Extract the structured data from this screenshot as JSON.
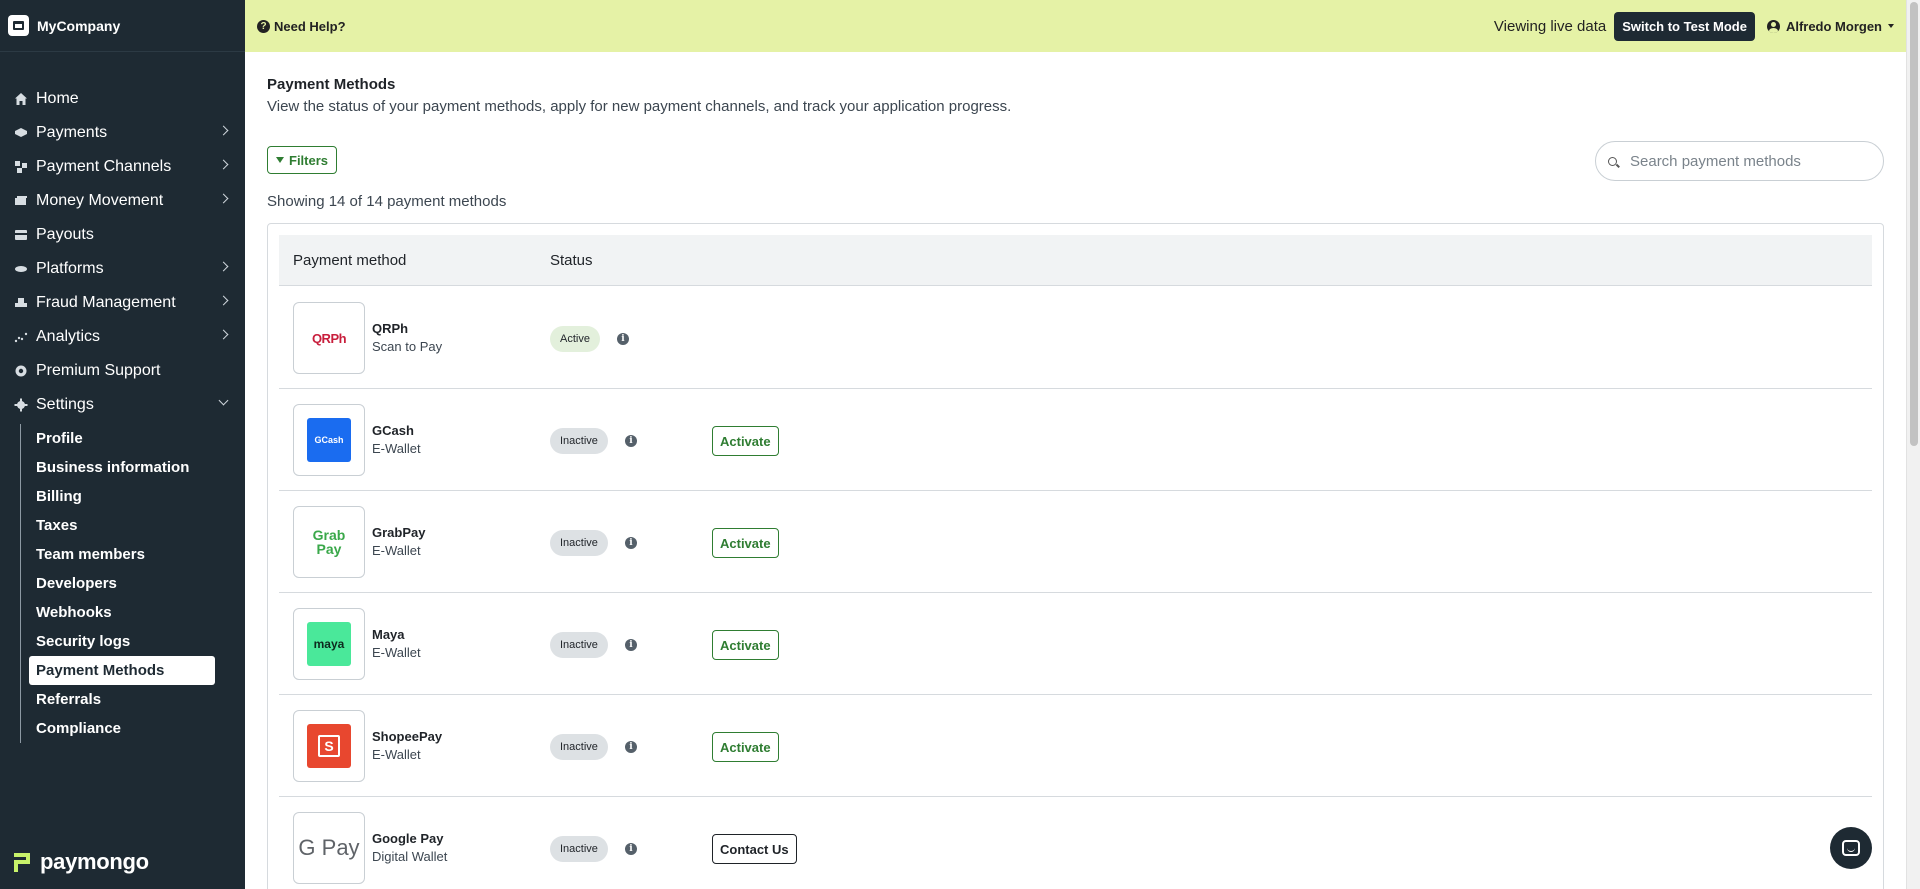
{
  "brand": {
    "name": "MyCompany",
    "logo_text": "paymongo"
  },
  "topbar": {
    "help_label": "Need Help?",
    "live_label": "Viewing live data",
    "test_mode_label": "Switch to Test Mode",
    "user_name": "Alfredo Morgen"
  },
  "sidebar": {
    "items": [
      {
        "label": "Home",
        "icon": "home-icon",
        "has_chevron": false
      },
      {
        "label": "Payments",
        "icon": "payments-icon",
        "has_chevron": true
      },
      {
        "label": "Payment Channels",
        "icon": "payment-channels-icon",
        "has_chevron": true
      },
      {
        "label": "Money Movement",
        "icon": "money-movement-icon",
        "has_chevron": true
      },
      {
        "label": "Payouts",
        "icon": "payouts-icon",
        "has_chevron": false
      },
      {
        "label": "Platforms",
        "icon": "platforms-icon",
        "has_chevron": true
      },
      {
        "label": "Fraud Management",
        "icon": "fraud-icon",
        "has_chevron": true
      },
      {
        "label": "Analytics",
        "icon": "analytics-icon",
        "has_chevron": true
      },
      {
        "label": "Premium Support",
        "icon": "support-icon",
        "has_chevron": false
      },
      {
        "label": "Settings",
        "icon": "settings-icon",
        "has_chevron": true,
        "expanded": true
      }
    ],
    "settings_sub": [
      "Profile",
      "Business information",
      "Billing",
      "Taxes",
      "Team members",
      "Developers",
      "Webhooks",
      "Security logs",
      "Payment Methods",
      "Referrals",
      "Compliance"
    ],
    "active_sub": "Payment Methods"
  },
  "main": {
    "title": "Payment Methods",
    "subtitle": "View the status of your payment methods, apply for new payment channels, and track your application progress.",
    "filters_label": "Filters",
    "search_placeholder": "Search payment methods",
    "showing": "Showing 14 of 14 payment methods",
    "columns": [
      "Payment method",
      "Status"
    ],
    "rows": [
      {
        "name": "QRPh",
        "type": "Scan to Pay",
        "status": "Active",
        "action": "",
        "logo_text": "QRPh"
      },
      {
        "name": "GCash",
        "type": "E-Wallet",
        "status": "Inactive",
        "action": "Activate",
        "logo_text": "GCash"
      },
      {
        "name": "GrabPay",
        "type": "E-Wallet",
        "status": "Inactive",
        "action": "Activate",
        "logo_text": "Grab Pay"
      },
      {
        "name": "Maya",
        "type": "E-Wallet",
        "status": "Inactive",
        "action": "Activate",
        "logo_text": "maya"
      },
      {
        "name": "ShopeePay",
        "type": "E-Wallet",
        "status": "Inactive",
        "action": "Activate",
        "logo_text": "S"
      },
      {
        "name": "Google Pay",
        "type": "Digital Wallet",
        "status": "Inactive",
        "action": "Contact Us",
        "logo_text": "G Pay"
      }
    ]
  },
  "colors": {
    "sidebar_bg": "#1e2a33",
    "topbar_bg": "#e5f2a6",
    "accent_green": "#2f7d32",
    "active_badge": "#e3f0dc",
    "inactive_badge": "#dde1e4",
    "brand_lime": "#c8f26a"
  }
}
